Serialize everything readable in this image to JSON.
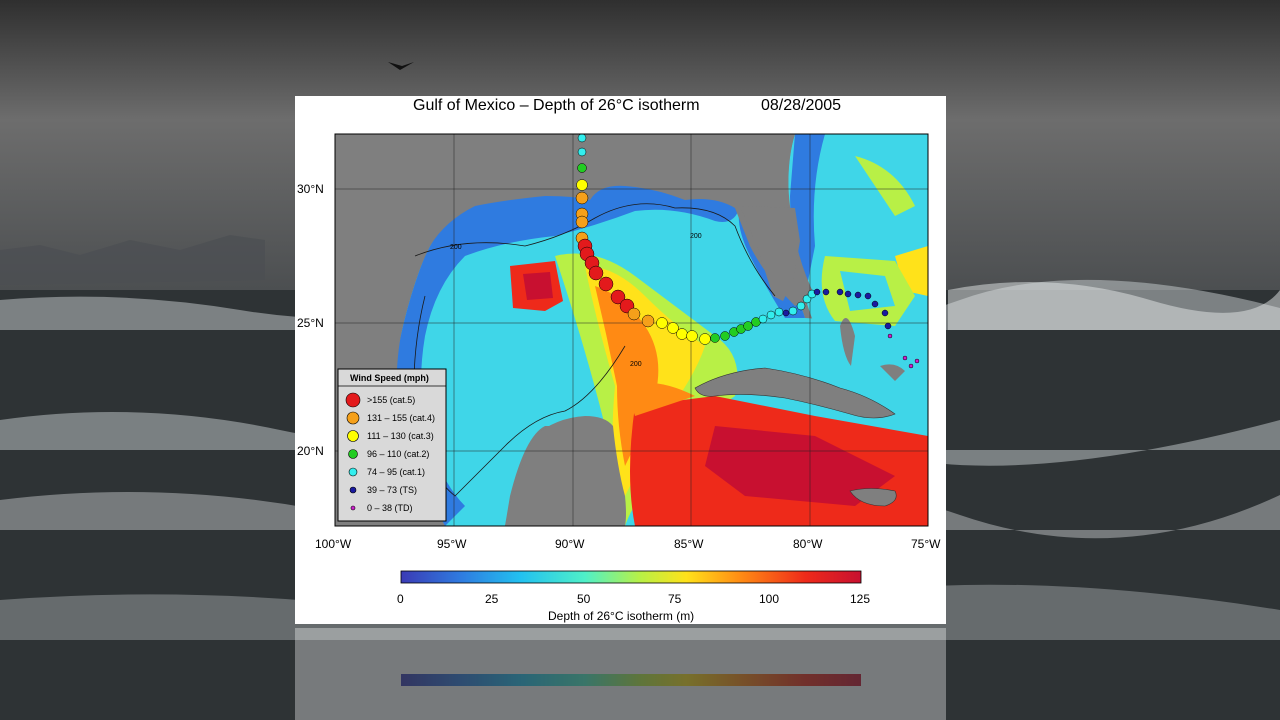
{
  "title": "Gulf of Mexico – Depth of 26°C isotherm",
  "date": "08/28/2005",
  "lon_ticks": [
    "100°W",
    "95°W",
    "90°W",
    "85°W",
    "80°W",
    "75°W"
  ],
  "lat_ticks": [
    "30°N",
    "25°N",
    "20°N"
  ],
  "contour_label": "200",
  "legend": {
    "title": "Wind Speed (mph)",
    "items": [
      {
        "label": ">155 (cat.5)",
        "color": "#e31a1c"
      },
      {
        "label": "131 – 155 (cat.4)",
        "color": "#f5a01a"
      },
      {
        "label": "111 – 130 (cat.3)",
        "color": "#ffff00"
      },
      {
        "label": "96 – 110 (cat.2)",
        "color": "#22cc22"
      },
      {
        "label": "74 – 95 (cat.1)",
        "color": "#33eeee"
      },
      {
        "label": "39 – 73 (TS)",
        "color": "#1a1aa0"
      },
      {
        "label": "0 – 38 (TD)",
        "color": "#cc22cc"
      }
    ]
  },
  "colorbar": {
    "ticks": [
      "0",
      "25",
      "50",
      "75",
      "100",
      "125"
    ],
    "label": "Depth of 26°C isotherm (m)",
    "colors": [
      "#3b3bb5",
      "#2f7be0",
      "#22c1f0",
      "#4ff0c8",
      "#b8f046",
      "#ffe21a",
      "#ff8a14",
      "#ee2a1a",
      "#c81030"
    ]
  },
  "colors": {
    "land": "#7f7f7f",
    "ocean_mid": "#3fd6e8"
  }
}
